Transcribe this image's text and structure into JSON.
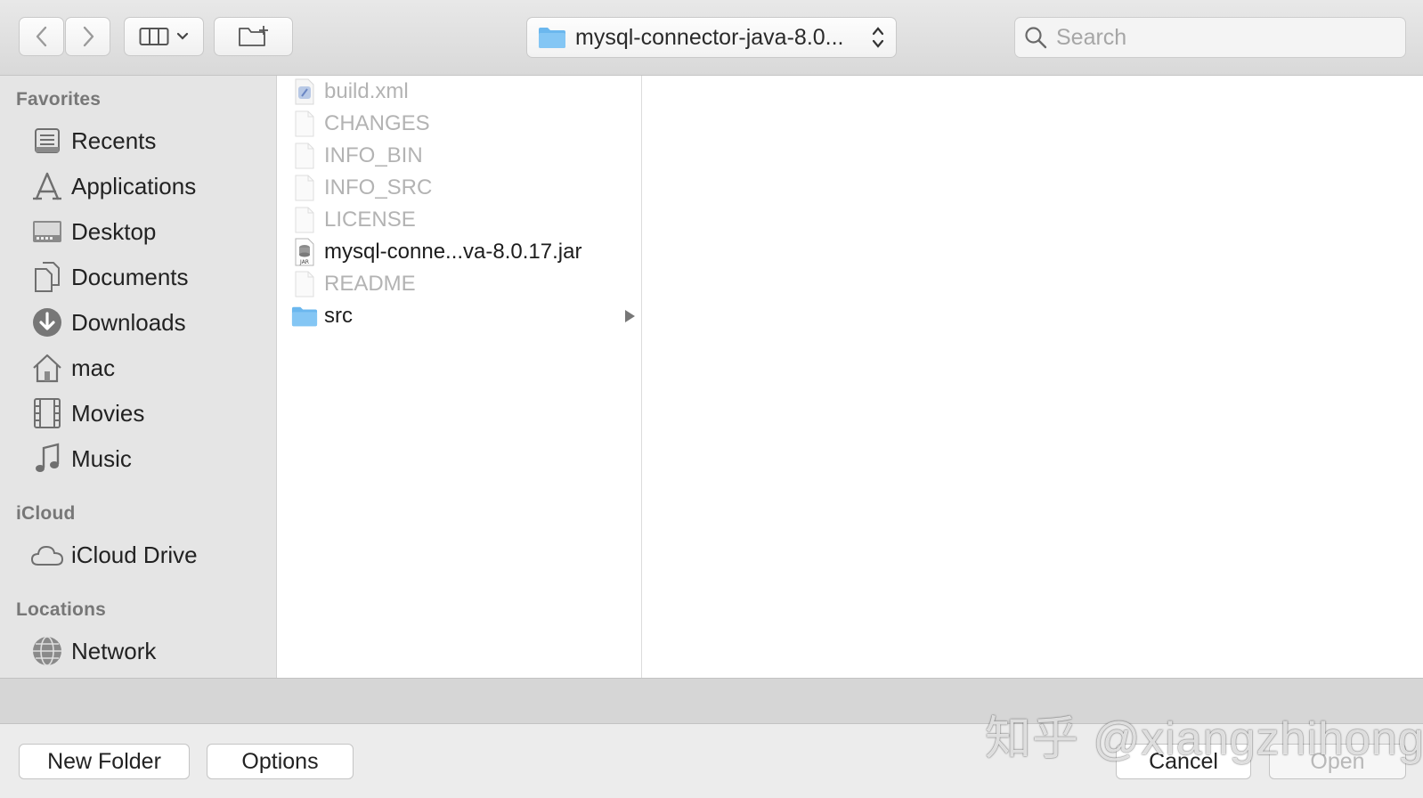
{
  "toolbar": {
    "path_label": "mysql-connector-java-8.0...",
    "search_placeholder": "Search"
  },
  "sidebar": {
    "favorites_heading": "Favorites",
    "favorites": [
      {
        "label": "Recents",
        "icon": "recents-icon"
      },
      {
        "label": "Applications",
        "icon": "applications-icon"
      },
      {
        "label": "Desktop",
        "icon": "desktop-icon"
      },
      {
        "label": "Documents",
        "icon": "documents-icon"
      },
      {
        "label": "Downloads",
        "icon": "downloads-icon"
      },
      {
        "label": "mac",
        "icon": "home-icon"
      },
      {
        "label": "Movies",
        "icon": "movies-icon"
      },
      {
        "label": "Music",
        "icon": "music-icon"
      }
    ],
    "icloud_heading": "iCloud",
    "icloud": [
      {
        "label": "iCloud Drive",
        "icon": "cloud-icon"
      }
    ],
    "locations_heading": "Locations",
    "locations": [
      {
        "label": "Network",
        "icon": "network-icon"
      }
    ]
  },
  "files": [
    {
      "name": "build.xml",
      "icon": "xml-file-icon",
      "enabled": false
    },
    {
      "name": "CHANGES",
      "icon": "document-icon",
      "enabled": false
    },
    {
      "name": "INFO_BIN",
      "icon": "document-icon",
      "enabled": false
    },
    {
      "name": "INFO_SRC",
      "icon": "document-icon",
      "enabled": false
    },
    {
      "name": "LICENSE",
      "icon": "document-icon",
      "enabled": false
    },
    {
      "name": "mysql-conne...va-8.0.17.jar",
      "icon": "jar-file-icon",
      "enabled": true
    },
    {
      "name": "README",
      "icon": "document-icon",
      "enabled": false
    },
    {
      "name": "src",
      "icon": "folder-icon",
      "enabled": true,
      "has_children": true
    }
  ],
  "bottom": {
    "new_folder_label": "New Folder",
    "options_label": "Options",
    "cancel_label": "Cancel",
    "open_label": "Open"
  },
  "watermark": "知乎 @xiangzhihong",
  "colors": {
    "folder_blue": "#6bb7ee",
    "disabled_text": "#b3b3b3"
  }
}
